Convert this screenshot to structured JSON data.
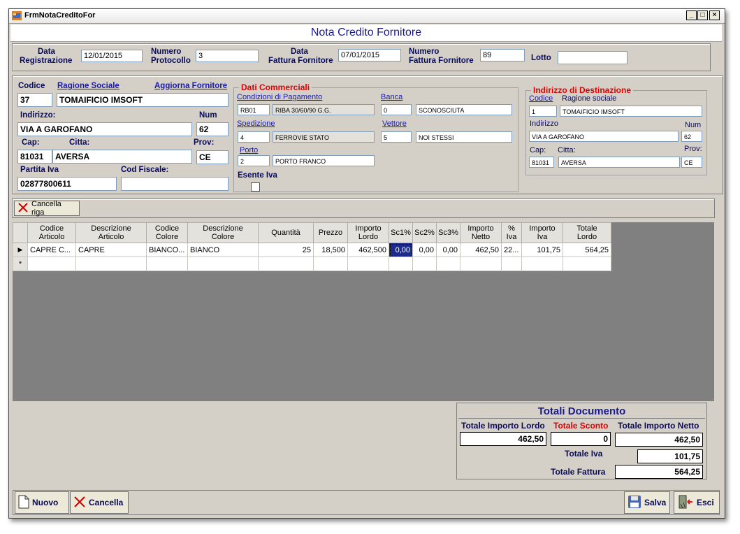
{
  "window": {
    "title": "FrmNotaCreditoFor",
    "minimize": "_",
    "maximize": "□",
    "close": "×"
  },
  "header": {
    "title": "Nota Credito Fornitore"
  },
  "top": {
    "data_registrazione_label1": "Data",
    "data_registrazione_label2": "Registrazione",
    "data_registrazione": "12/01/2015",
    "numero_protocollo_label1": "Numero",
    "numero_protocollo_label2": "Protocollo",
    "numero_protocollo": "3",
    "data_fattura_label1": "Data",
    "data_fattura_label2": "Fattura Fornitore",
    "data_fattura": "07/01/2015",
    "numero_fattura_label1": "Numero",
    "numero_fattura_label2": "Fattura Fornitore",
    "numero_fattura": "89",
    "lotto_label": "Lotto",
    "lotto": ""
  },
  "fornitore": {
    "codice_label": "Codice",
    "codice": "37",
    "ragione_sociale_label": "Ragione Sociale",
    "ragione_sociale": "TOMAIFICIO IMSOFT",
    "aggiorna_label": "Aggiorna Fornitore",
    "indirizzo_label": "Indirizzo:",
    "indirizzo": "VIA A GAROFANO",
    "num_label": "Num",
    "num": "62",
    "cap_label": "Cap:",
    "cap": "81031",
    "citta_label": "Citta:",
    "citta": "AVERSA",
    "prov_label": "Prov:",
    "prov": "CE",
    "partita_iva_label": "Partita Iva",
    "partita_iva": "02877800611",
    "cod_fiscale_label": "Cod Fiscale:",
    "cod_fiscale": ""
  },
  "dati_commerciali": {
    "title": "Dati Commerciali",
    "condizioni_label": "Condizioni di Pagamento",
    "condizioni_code": "RB01",
    "condizioni_desc": "RIBA 30/60/90 G.G.",
    "banca_label": "Banca",
    "banca_code": "0",
    "banca_desc": "SCONOSCIUTA",
    "spedizione_label": "Spedizione",
    "spedizione_code": "4",
    "spedizione_desc": "FERROVIE STATO",
    "vettore_label": "Vettore",
    "vettore_code": "5",
    "vettore_desc": "NOI STESSI",
    "porto_label": "Porto",
    "porto_code": "2",
    "porto_desc": "PORTO FRANCO",
    "esente_iva_label": "Esente Iva",
    "esente_iva_checked": false
  },
  "destinazione": {
    "title": "Indirizzo di Destinazione",
    "codice_label": "Codice",
    "codice": "1",
    "ragione_sociale_label": "Ragione sociale",
    "ragione_sociale": "TOMAIFICIO IMSOFT",
    "indirizzo_label": "Indirizzo",
    "indirizzo": "VIA A GAROFANO",
    "num_label": "Num",
    "num": "62",
    "cap_label": "Cap:",
    "cap": "81031",
    "citta_label": "Citta:",
    "citta": "AVERSA",
    "prov_label": "Prov:",
    "prov": "CE"
  },
  "toolbar": {
    "cancella_riga": "Cancella riga"
  },
  "grid": {
    "columns": [
      [
        "Codice",
        "Articolo"
      ],
      [
        "Descrizione",
        "Articolo"
      ],
      [
        "Codice",
        "Colore"
      ],
      [
        "Descrizione",
        "Colore"
      ],
      [
        "Quantità",
        ""
      ],
      [
        "Prezzo",
        ""
      ],
      [
        "Importo",
        "Lordo"
      ],
      [
        "Sc1%",
        ""
      ],
      [
        "Sc2%",
        ""
      ],
      [
        "Sc3%",
        ""
      ],
      [
        "Importo",
        "Netto"
      ],
      [
        "%",
        "Iva"
      ],
      [
        "Importo",
        "Iva"
      ],
      [
        "Totale",
        "Lordo"
      ]
    ],
    "rows": [
      [
        "CAPRE C...",
        "CAPRE",
        "BIANCO...",
        "BIANCO",
        "25",
        "18,500",
        "462,500",
        "0,00",
        "0,00",
        "0,00",
        "462,50",
        "22...",
        "101,75",
        "564,25"
      ]
    ],
    "row_marker": "▶",
    "new_row_marker": "*"
  },
  "totali": {
    "title": "Totali Documento",
    "importo_lordo_label": "Totale Importo Lordo",
    "importo_lordo": "462,50",
    "sconto_label": "Totale Sconto",
    "sconto": "0",
    "importo_netto_label": "Totale Importo Netto",
    "importo_netto": "462,50",
    "iva_label": "Totale Iva",
    "iva": "101,75",
    "fattura_label": "Totale Fattura",
    "fattura": "564,25"
  },
  "bottom": {
    "nuovo": "Nuovo",
    "cancella": "Cancella",
    "salva": "Salva",
    "esci": "Esci"
  }
}
